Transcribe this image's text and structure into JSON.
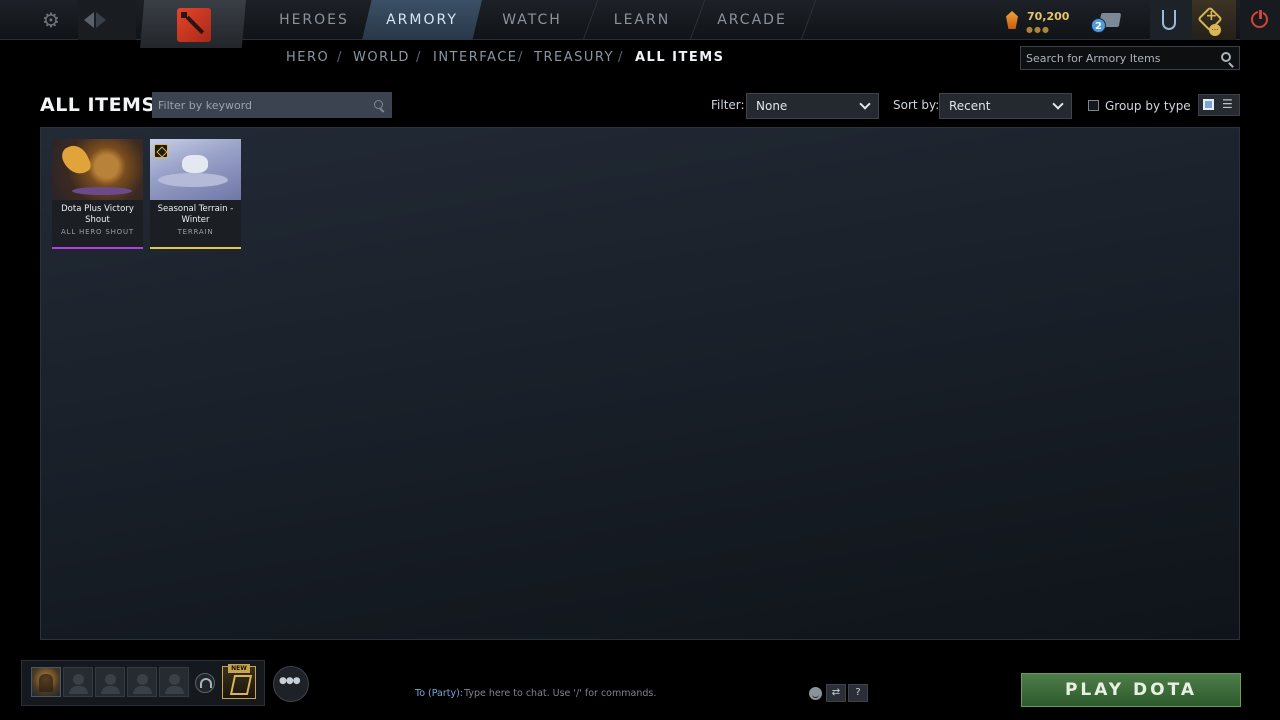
{
  "topnav": {
    "items": [
      "HEROES",
      "ARMORY",
      "WATCH",
      "LEARN",
      "ARCADE"
    ],
    "active": "ARMORY"
  },
  "currency": {
    "shards": "70,200",
    "shards_icon": "shards-icon"
  },
  "notifications": {
    "chat_count": "2"
  },
  "subnav": {
    "items": [
      "HERO",
      "WORLD",
      "INTERFACE",
      "TREASURY",
      "ALL ITEMS"
    ],
    "active": "ALL ITEMS"
  },
  "armory_search": {
    "placeholder": "Search for Armory Items"
  },
  "toolbar": {
    "title": "ALL ITEMS",
    "keyword_placeholder": "Filter by keyword",
    "filter_label": "Filter:",
    "filter_value": "None",
    "sort_label": "Sort by:",
    "sort_value": "Recent",
    "group_label": "Group by type"
  },
  "items": [
    {
      "name": "Dota Plus Victory Shout",
      "type": "ALL HERO SHOUT",
      "rarity_color": "#b23fe0"
    },
    {
      "name": "Seasonal Terrain - Winter",
      "type": "TERRAIN",
      "rarity_color": "#e6c940"
    }
  ],
  "bottom": {
    "battlepass_badge": "NEW",
    "chat_to": "To (Party):",
    "chat_placeholder": "Type here to chat. Use '/' for commands.",
    "help_label": "?",
    "play_label": "PLAY DOTA"
  },
  "colors": {
    "accent": "#3b5066",
    "play_green": "#3f6e3c",
    "gold": "#d9b554"
  }
}
